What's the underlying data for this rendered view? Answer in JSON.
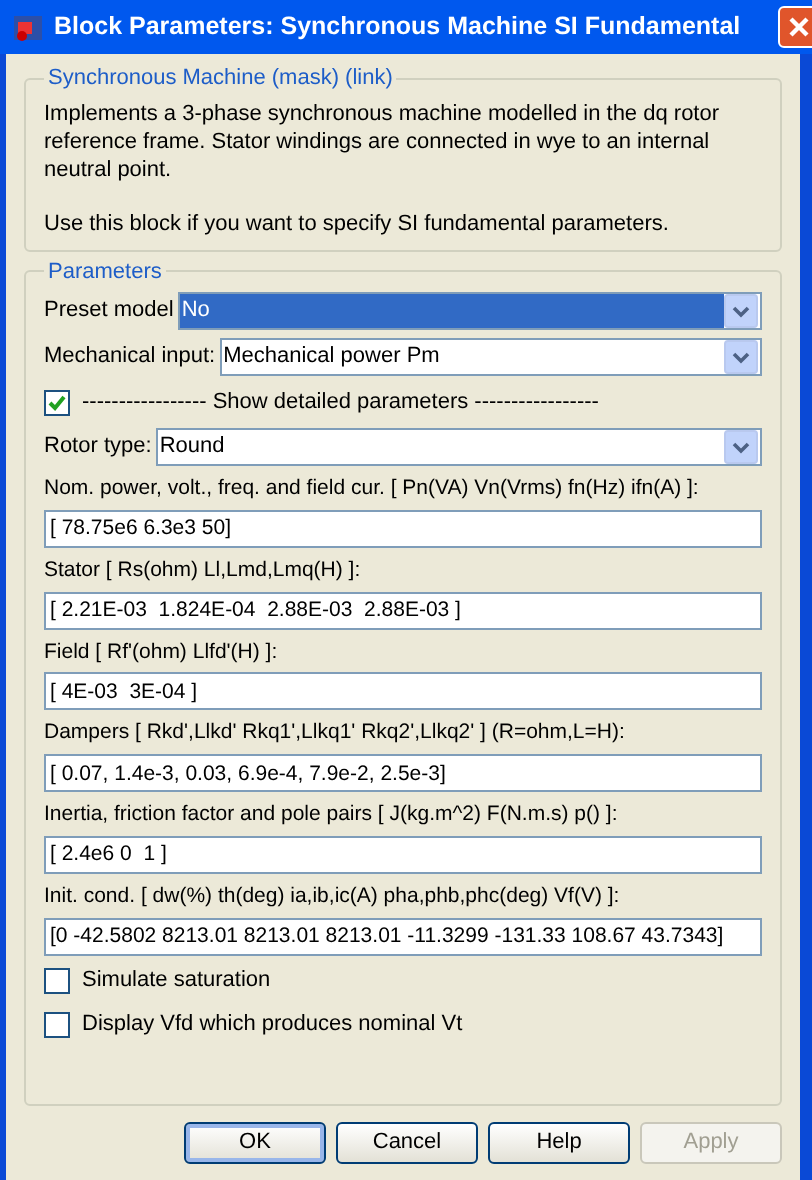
{
  "window": {
    "title": "Block Parameters: Synchronous Machine SI Fundamental"
  },
  "description": {
    "title": "Synchronous Machine (mask) (link)",
    "paragraphs": [
      "Implements a 3-phase synchronous machine modelled in the dq rotor reference frame. Stator windings are connected in wye to an internal neutral point.",
      "Use this block if you want to specify SI fundamental parameters."
    ]
  },
  "parameters": {
    "title": "Parameters",
    "items": [
      {
        "kind": "dropdown",
        "label": "Preset  model",
        "value": "No",
        "highlighted": true
      },
      {
        "kind": "dropdown",
        "label": "Mechanical input:",
        "value": "Mechanical power Pm",
        "highlighted": false
      },
      {
        "kind": "separator-check",
        "label": "----------------- Show detailed parameters -----------------",
        "checked": true
      },
      {
        "kind": "dropdown",
        "label": "Rotor type:",
        "value": "Round",
        "highlighted": false
      },
      {
        "kind": "field",
        "label": "Nom. power, volt., freq. and field cur. [ Pn(VA) Vn(Vrms) fn(Hz) ifn(A) ]:",
        "value": "[ 78.75e6 6.3e3 50]"
      },
      {
        "kind": "field",
        "label": "Stator [ Rs(ohm)  Ll,Lmd,Lmq(H) ]:",
        "value": "[ 2.21E-03  1.824E-04  2.88E-03  2.88E-03 ]"
      },
      {
        "kind": "field",
        "label": "Field [ Rf'(ohm)  Llfd'(H) ]:",
        "value": "[ 4E-03  3E-04 ]"
      },
      {
        "kind": "field",
        "label": "Dampers [ Rkd',Llkd'  Rkq1',Llkq1'  Rkq2',Llkq2'  ] (R=ohm,L=H):",
        "value": "[ 0.07, 1.4e-3, 0.03, 6.9e-4, 7.9e-2, 2.5e-3]"
      },
      {
        "kind": "field",
        "label": "Inertia, friction factor and pole pairs [ J(kg.m^2)  F(N.m.s)  p() ]:",
        "value": "[ 2.4e6 0  1 ]"
      },
      {
        "kind": "field",
        "label": "Init. cond. [ dw(%)  th(deg)  ia,ib,ic(A)  pha,phb,phc(deg)  Vf(V) ]:",
        "value": "[0 -42.5802 8213.01 8213.01 8213.01 -11.3299 -131.33 108.67 43.7343]"
      },
      {
        "kind": "checkbox",
        "label": "Simulate saturation",
        "checked": false
      },
      {
        "kind": "checkbox",
        "label": "Display Vfd which produces nominal Vt",
        "checked": false
      }
    ]
  },
  "buttons": [
    {
      "label": "OK",
      "default": true,
      "disabled": false
    },
    {
      "label": "Cancel",
      "default": false,
      "disabled": false
    },
    {
      "label": "Help",
      "default": false,
      "disabled": false
    },
    {
      "label": "Apply",
      "default": false,
      "disabled": true
    }
  ]
}
